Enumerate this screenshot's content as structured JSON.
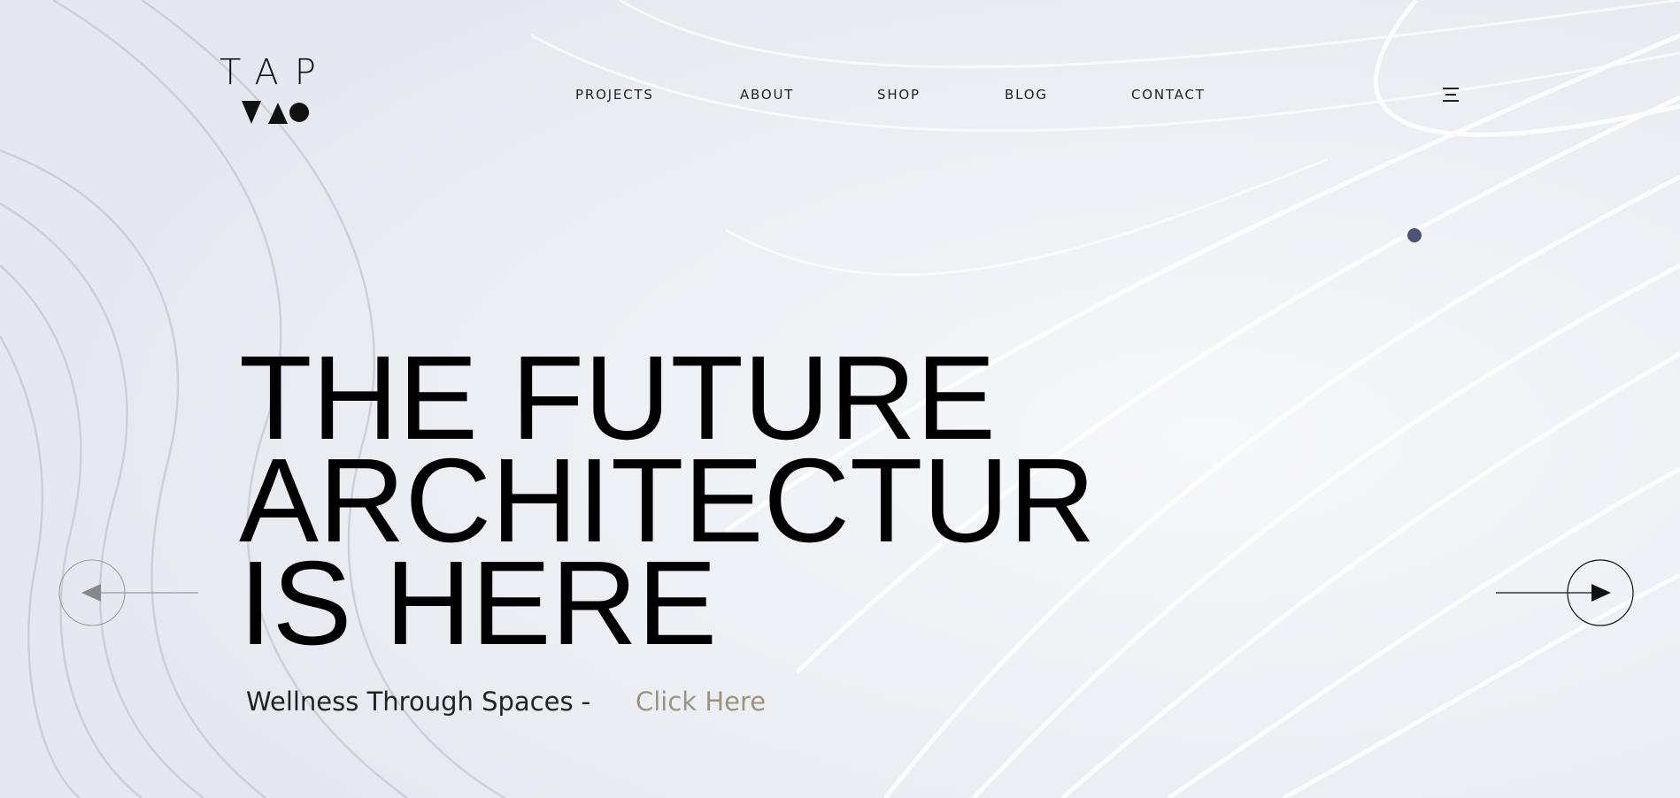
{
  "brand": {
    "name": "TAP",
    "accent_dot_color": "#4a5475"
  },
  "nav": {
    "items": [
      {
        "label": "PROJECTS"
      },
      {
        "label": "ABOUT"
      },
      {
        "label": "SHOP"
      },
      {
        "label": "BLOG"
      },
      {
        "label": "CONTACT"
      }
    ],
    "menu_icon": "hamburger-menu-icon"
  },
  "hero": {
    "title_lines": [
      "THE FUTURE",
      "ARCHITECTURE",
      "IS HERE"
    ],
    "tagline": "Wellness Through Spaces -",
    "cta_label": "Click Here",
    "cta_color": "#9a957f"
  },
  "slider": {
    "prev_icon": "arrow-left-icon",
    "next_icon": "arrow-right-icon"
  }
}
